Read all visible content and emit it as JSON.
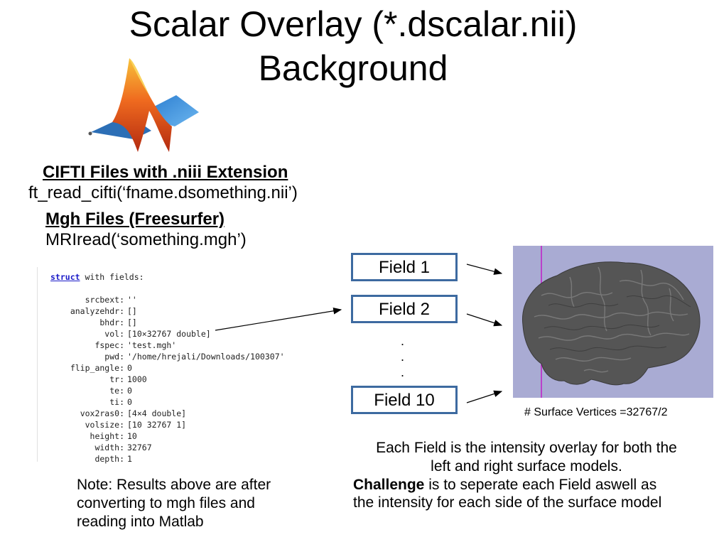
{
  "slide": {
    "title_line1": "Scalar Overlay (*.dscalar.nii)",
    "title_line2": "Background"
  },
  "cifti": {
    "heading": "CIFTI Files with .niii Extension",
    "code": "ft_read_cifti(‘fname.dsomething.nii’)"
  },
  "mgh": {
    "heading": "Mgh Files (Freesurfer)",
    "code": "MRIread(‘something.mgh’)"
  },
  "matlab_output": {
    "header_keyword": "struct",
    "header_rest": " with fields:",
    "fields": [
      {
        "key": "srcbext:",
        "value": "''"
      },
      {
        "key": "analyzehdr:",
        "value": "[]"
      },
      {
        "key": "bhdr:",
        "value": "[]"
      },
      {
        "key": "vol:",
        "value": "[10×32767 double]"
      },
      {
        "key": "fspec:",
        "value": "'test.mgh'"
      },
      {
        "key": "pwd:",
        "value": "'/home/hrejali/Downloads/100307'"
      },
      {
        "key": "flip_angle:",
        "value": "0"
      },
      {
        "key": "tr:",
        "value": "1000"
      },
      {
        "key": "te:",
        "value": "0"
      },
      {
        "key": "ti:",
        "value": "0"
      },
      {
        "key": "vox2ras0:",
        "value": "[4×4 double]"
      },
      {
        "key": "volsize:",
        "value": "[10 32767 1]"
      },
      {
        "key": "height:",
        "value": "10"
      },
      {
        "key": "width:",
        "value": "32767"
      },
      {
        "key": "depth:",
        "value": "1"
      }
    ]
  },
  "fields": {
    "field1": "Field 1",
    "field2": "Field 2",
    "field10": "Field 10",
    "dot": "."
  },
  "surface": {
    "caption": "# Surface Vertices =32767/2"
  },
  "description": {
    "line1": "Each Field is the intensity overlay for both the",
    "line2": "left and right surface models.",
    "challenge_bold": "Challenge",
    "challenge_rest": " is to seperate each Field aswell as",
    "line4": "the intensity for each side of the surface model"
  },
  "note": {
    "line1": "Note: Results above are after",
    "line2": "converting to mgh files and",
    "line3": "reading into Matlab"
  },
  "colors": {
    "box_border": "#3d6aa0",
    "surface_bg": "#a9abd3",
    "brain": "#555555",
    "midline": "#c01ec8"
  }
}
